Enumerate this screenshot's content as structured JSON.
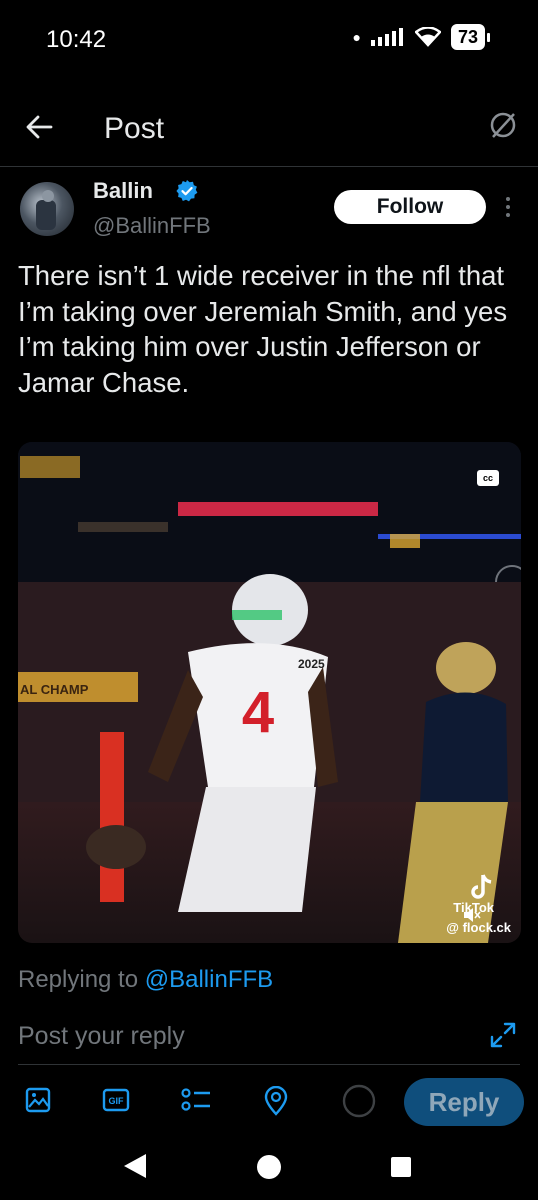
{
  "status_bar": {
    "time": "10:42",
    "battery": "73"
  },
  "header": {
    "title": "Post"
  },
  "post": {
    "author_name": "Ballin",
    "author_handle": "@BallinFFB",
    "follow_label": "Follow",
    "text": "There isn’t 1 wide receiver in the nfl that I’m taking over Jeremiah Smith, and yes I’m taking him over Justin Jefferson or Jamar Chase.",
    "media": {
      "cc_label": "cc",
      "jersey_number": "4",
      "helmet_logo": "2025",
      "banner_text": "AL CHAMP",
      "tiktok_label": "TikTok",
      "watermark_handle": "@ flock.ck"
    }
  },
  "reply": {
    "replying_to_label": "Replying to",
    "replying_to_handle": "@BallinFFB",
    "placeholder": "Post your reply",
    "button_label": "Reply"
  },
  "colors": {
    "accent": "#1d9bf0",
    "background": "#000000",
    "secondary_text": "#71767b"
  }
}
